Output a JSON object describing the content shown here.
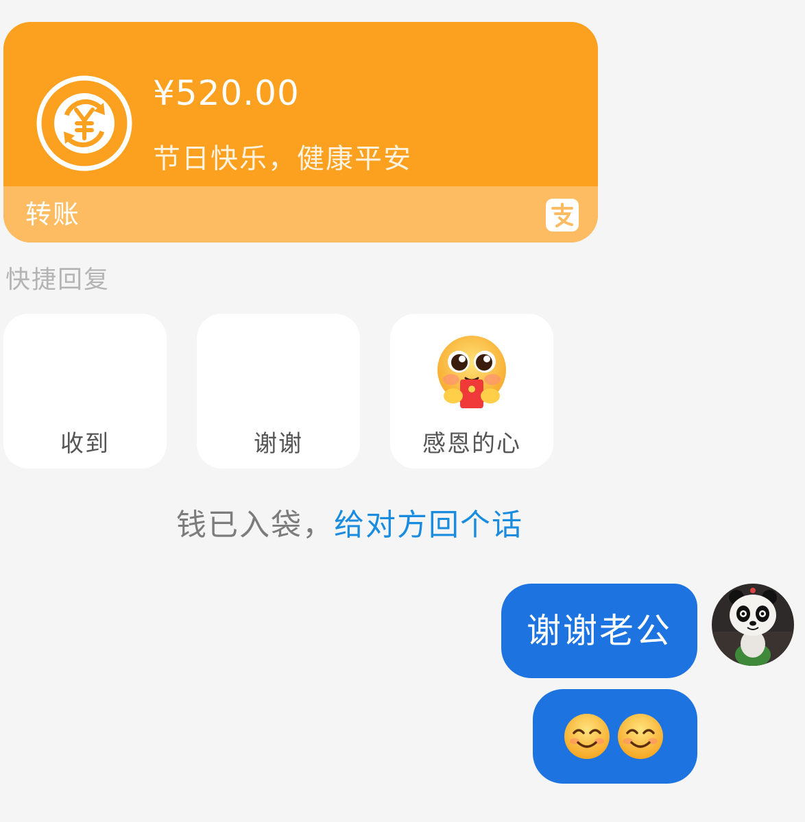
{
  "transfer": {
    "amount": "¥520.00",
    "remark": "节日快乐，健康平安",
    "label": "转账",
    "icon": "yuan-exchange-icon",
    "logo": "alipay-logo",
    "colors": {
      "top": "#fca11f",
      "bottom": "#fdbb62"
    }
  },
  "quick_reply": {
    "title": "快捷回复",
    "options": [
      {
        "label": "收到"
      },
      {
        "label": "谢谢"
      },
      {
        "label": "感恩的心",
        "icon": "red-envelope-emoji-icon"
      }
    ]
  },
  "notice": {
    "text": "钱已入袋，",
    "link": "给对方回个话"
  },
  "messages": [
    {
      "text": "谢谢老公",
      "sender": "self"
    },
    {
      "emoji": [
        "smiling-face-emoji",
        "smiling-face-emoji"
      ],
      "sender": "self"
    }
  ],
  "avatar": {
    "icon": "panda-avatar"
  },
  "colors": {
    "bubble": "#1d74e1",
    "link": "#1a8ce0",
    "background": "#f5f5f5"
  }
}
